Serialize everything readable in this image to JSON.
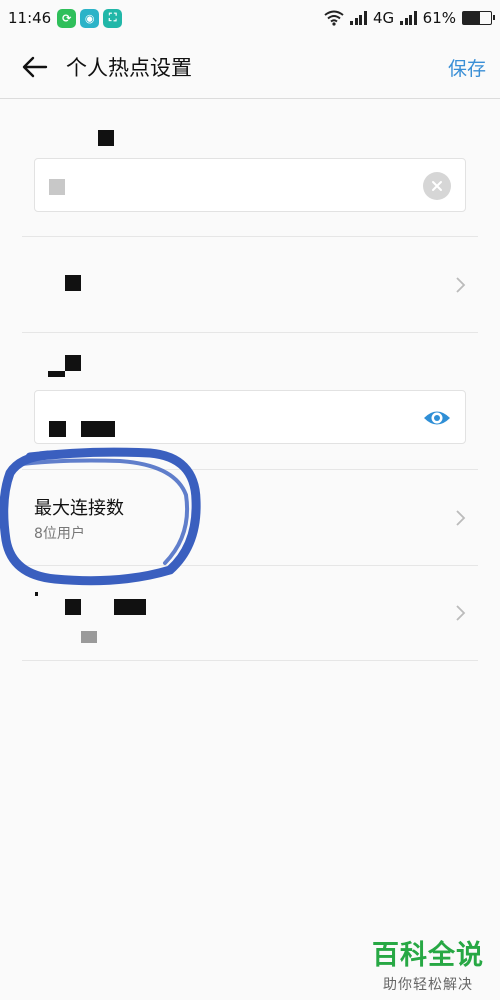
{
  "status_bar": {
    "time": "11:46",
    "network": "4G",
    "battery_text": "61%",
    "battery_level": 0.61
  },
  "header": {
    "title": "个人热点设置",
    "save_label": "保存"
  },
  "max_connections": {
    "title": "最大连接数",
    "value": "8位用户"
  },
  "watermark": {
    "title": "百科全说",
    "subtitle": "助你轻松解决"
  },
  "colors": {
    "accent": "#3a8fd6",
    "scribble": "#3a5fbf",
    "watermark": "#27a844"
  }
}
